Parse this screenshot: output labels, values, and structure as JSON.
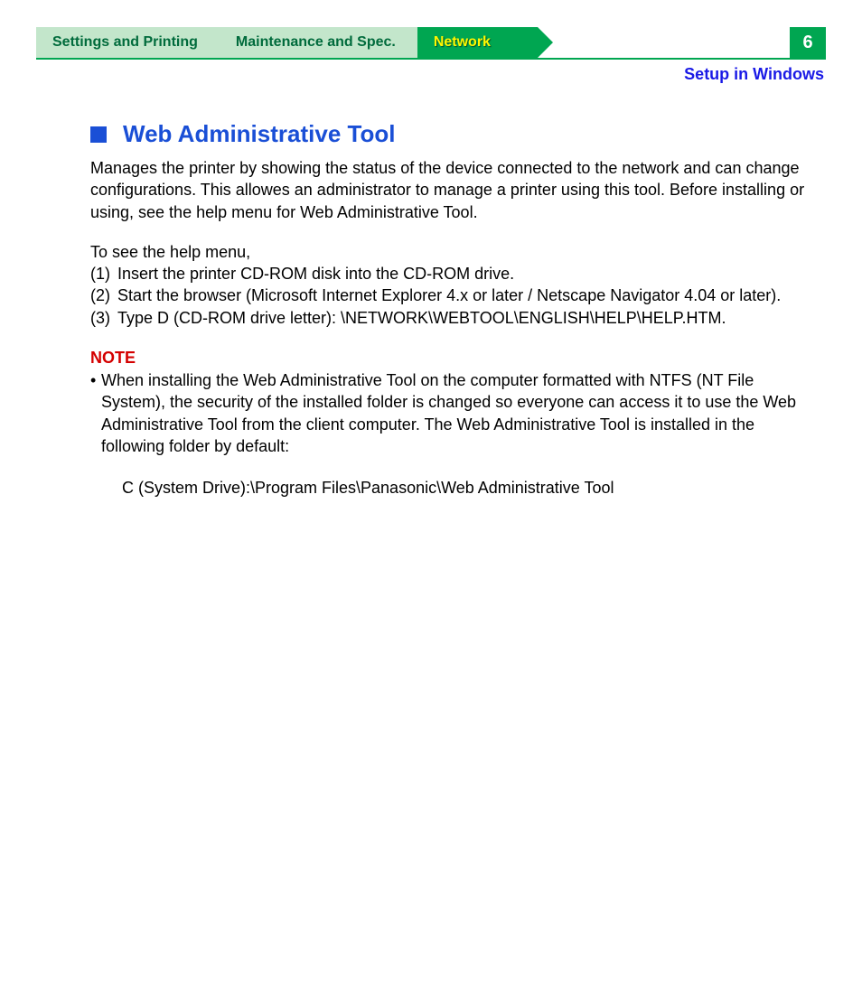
{
  "tabs": {
    "settings": "Settings and Printing",
    "maintenance": "Maintenance and Spec.",
    "network": "Network"
  },
  "page_number": "6",
  "subheader": "Setup in Windows",
  "title": "Web Administrative Tool",
  "intro": "Manages the printer by showing the status of the device connected to the network and can change configurations. This allowes an administrator to manage a printer using this tool. Before installing or using, see the help menu for Web Administrative Tool.",
  "help_lead": "To see the help menu,",
  "steps": [
    {
      "n": "(1)",
      "t": "Insert the printer CD-ROM disk into the CD-ROM drive."
    },
    {
      "n": "(2)",
      "t": "Start the browser (Microsoft Internet Explorer 4.x or later / Netscape Navigator 4.04 or later)."
    },
    {
      "n": "(3)",
      "t": "Type D (CD-ROM drive letter): \\NETWORK\\WEBTOOL\\ENGLISH\\HELP\\HELP.HTM."
    }
  ],
  "note_label": "NOTE",
  "note_bullet_mark": "•",
  "note_text": "When installing the Web Administrative Tool on the computer formatted with NTFS (NT File System), the security of the installed folder is changed so everyone can access it to use the Web Administrative Tool from the client computer. The Web Administrative Tool is installed in the following folder by default:",
  "install_path": "C (System Drive):\\Program Files\\Panasonic\\Web Administrative Tool"
}
